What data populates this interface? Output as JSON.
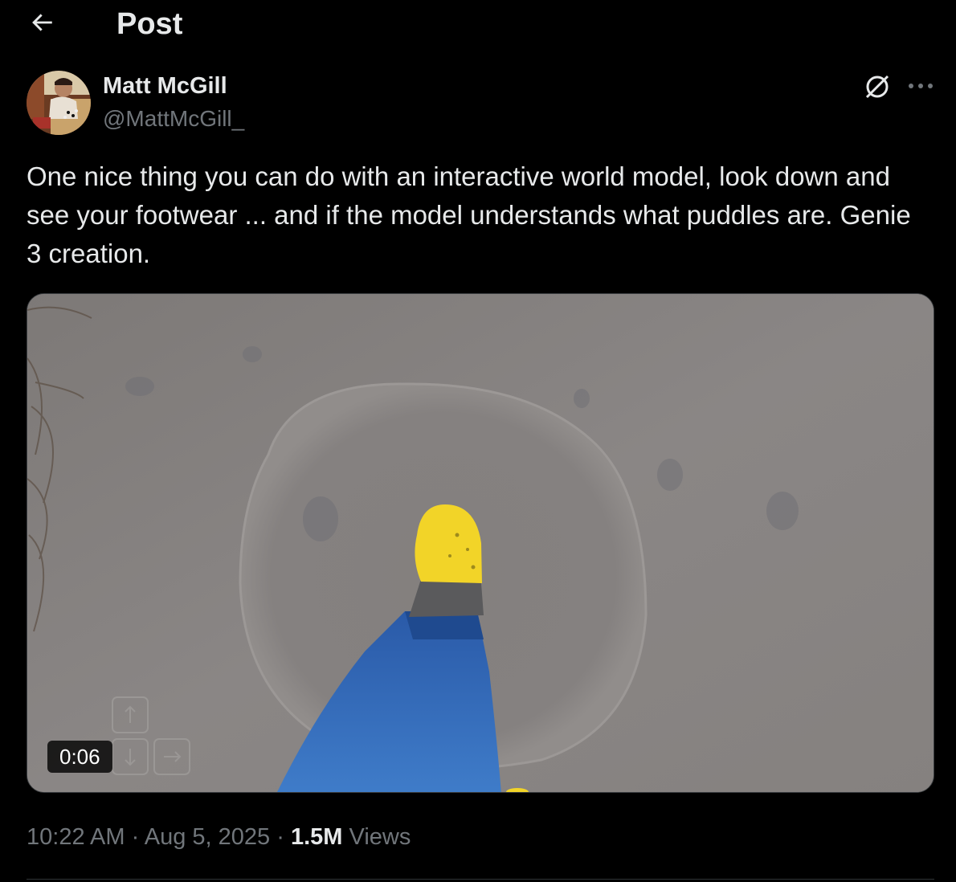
{
  "header": {
    "title": "Post",
    "back_icon": "arrow-left-icon"
  },
  "author": {
    "name": "Matt McGill",
    "handle": "@MattMcGill_"
  },
  "actions": {
    "grok_icon": "grok-icon",
    "more_icon": "more-icon"
  },
  "tweet": {
    "text": "One nice thing you can do with an interactive world model, look down and see your footwear ... and if the model understands what puddles are. Genie 3 creation."
  },
  "media": {
    "type": "video",
    "duration": "0:06"
  },
  "meta": {
    "time": "10:22 AM",
    "separator": "·",
    "date": "Aug 5, 2025",
    "views_count": "1.5M",
    "views_label": "Views"
  },
  "colors": {
    "background": "#000000",
    "text_primary": "#e7e9ea",
    "text_secondary": "#71767b",
    "boot_yellow": "#f2d428",
    "jeans_blue": "#3a6fc0"
  }
}
